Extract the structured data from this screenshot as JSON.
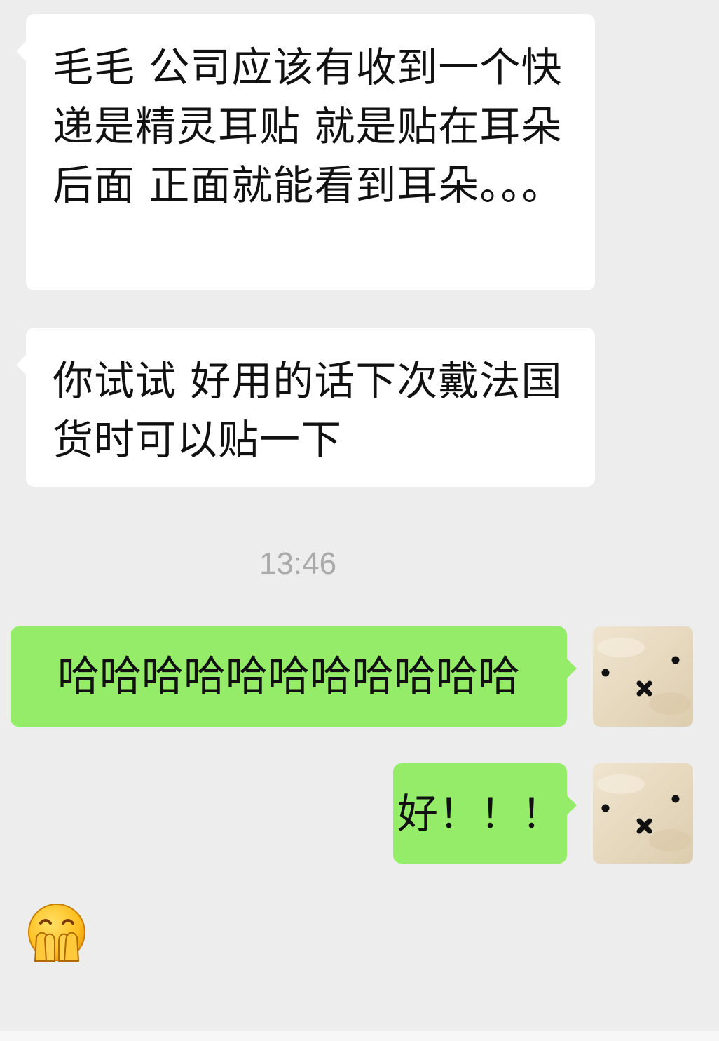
{
  "messages": [
    {
      "direction": "incoming",
      "text": "毛毛 公司应该有收到一个快递是精灵耳贴 就是贴在耳朵后面 正面就能看到耳朵。。。"
    },
    {
      "direction": "incoming",
      "text": "你试试 好用的话下次戴法国货时可以贴一下"
    },
    {
      "direction": "outgoing",
      "text": "哈哈哈哈哈哈哈哈哈哈哈"
    },
    {
      "direction": "outgoing",
      "text": "好！！！"
    }
  ],
  "timestamp": "13:46",
  "sticker": {
    "icon": "laughing-face-covering-mouth-emoji"
  },
  "avatar": {
    "icon": "bunny-face-icon"
  },
  "colors": {
    "background": "#ededed",
    "incoming_bubble": "#ffffff",
    "outgoing_bubble": "#95ec69",
    "text": "#111111",
    "timestamp": "#aaaaaa"
  }
}
